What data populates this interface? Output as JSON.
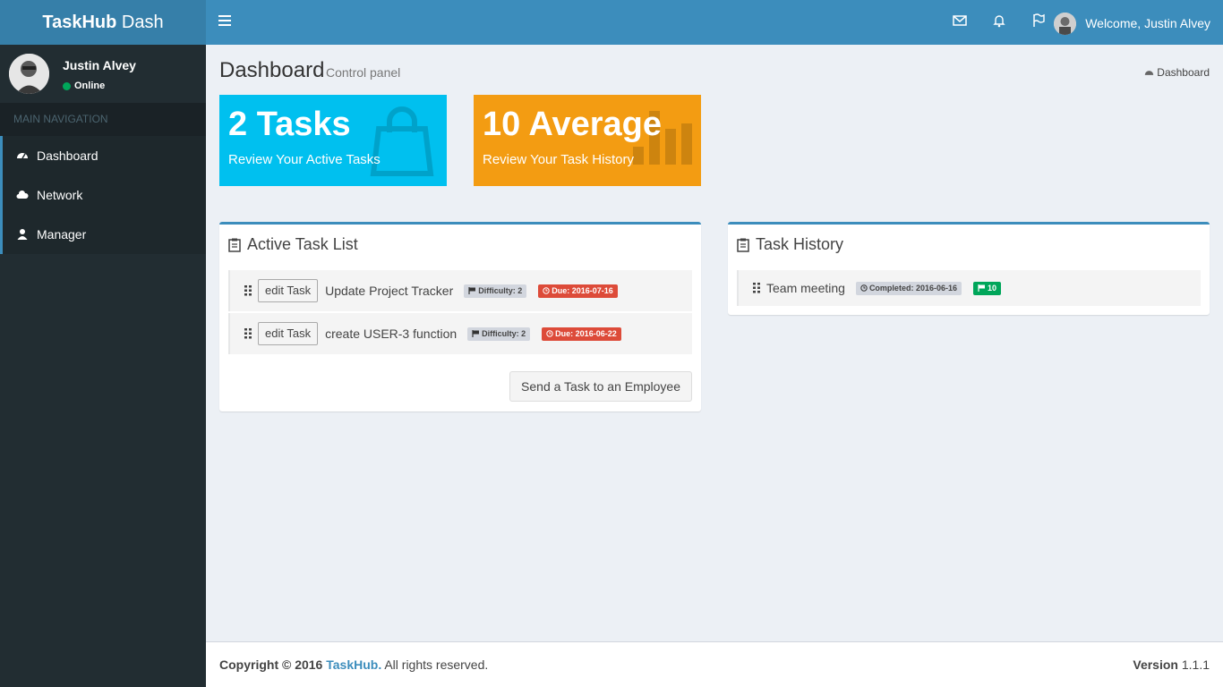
{
  "app": {
    "logo_bold": "TaskHub",
    "logo_rest": " Dash"
  },
  "navbar": {
    "welcome": "Welcome, Justin Alvey",
    "icons": [
      "envelope-icon",
      "bell-icon",
      "flag-icon"
    ]
  },
  "sidebar": {
    "user_name": "Justin Alvey",
    "status": "Online",
    "nav_header": "MAIN NAVIGATION",
    "items": [
      {
        "label": "Dashboard",
        "icon": "dashboard-icon"
      },
      {
        "label": "Network",
        "icon": "cloud-icon"
      },
      {
        "label": "Manager",
        "icon": "user-icon"
      }
    ]
  },
  "page": {
    "title": "Dashboard",
    "subtitle": "Control panel",
    "breadcrumb": "Dashboard"
  },
  "stats": [
    {
      "value": "2 Tasks",
      "label": "Review Your Active Tasks",
      "color": "#00c0ef"
    },
    {
      "value": "10 Average",
      "label": "Review Your Task History",
      "color": "#f39c12"
    }
  ],
  "active_tasks": {
    "title": "Active Task List",
    "edit_label": "edit Task",
    "rows": [
      {
        "name": "Update Project Tracker",
        "difficulty": "Difficulty: 2",
        "due": "Due: 2016-07-16"
      },
      {
        "name": "create USER-3 function",
        "difficulty": "Difficulty: 2",
        "due": "Due: 2016-06-22"
      }
    ],
    "send_label": "Send a Task to an Employee"
  },
  "task_history": {
    "title": "Task History",
    "rows": [
      {
        "name": "Team meeting",
        "completed": "Completed: 2016-06-16",
        "score": "10"
      }
    ]
  },
  "footer": {
    "copyright": "Copyright © 2016 ",
    "brand": "TaskHub.",
    "rights": " All rights reserved.",
    "version_label": "Version",
    "version": " 1.1.1"
  }
}
